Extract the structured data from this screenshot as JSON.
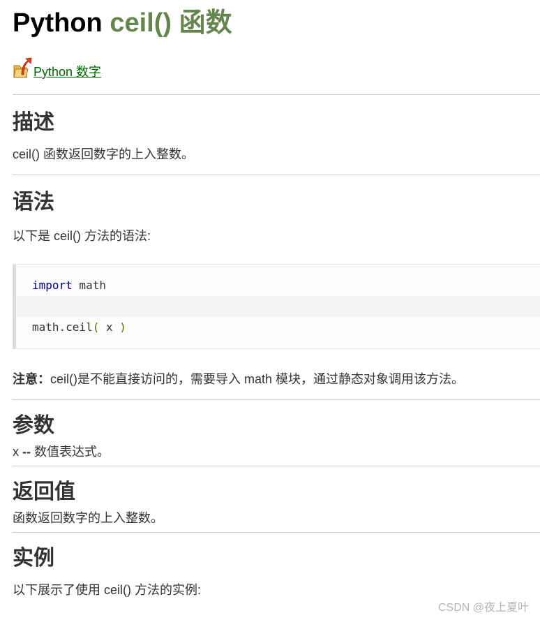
{
  "header": {
    "title_prefix": "Python ",
    "title_accent": "ceil() 函数",
    "back_link": " Python 数字",
    "back_icon": "folder-up-arrow-icon"
  },
  "sections": {
    "description": {
      "title": "描述",
      "text": "ceil() 函数返回数字的上入整数。"
    },
    "syntax": {
      "title": "语法",
      "intro": "以下是 ceil() 方法的语法:",
      "code": {
        "line1_keyword": "import",
        "line1_rest": " math",
        "line3_call": "math.ceil",
        "line3_open": "(",
        "line3_arg": " x ",
        "line3_close": ")"
      },
      "note_label": "注意：",
      "note_text": "ceil()是不能直接访问的，需要导入 math 模块，通过静态对象调用该方法。"
    },
    "params": {
      "title": "参数",
      "param_name": "x",
      "param_sep": " -- ",
      "param_desc": "数值表达式。"
    },
    "returns": {
      "title": "返回值",
      "text": "函数返回数字的上入整数。"
    },
    "example": {
      "title": "实例",
      "text": "以下展示了使用 ceil() 方法的实例:"
    }
  },
  "watermark": "CSDN @夜上夏叶",
  "colors": {
    "title_accent": "#64854c",
    "link": "#006600",
    "code_keyword": "#000088",
    "code_punct": "#666600"
  }
}
